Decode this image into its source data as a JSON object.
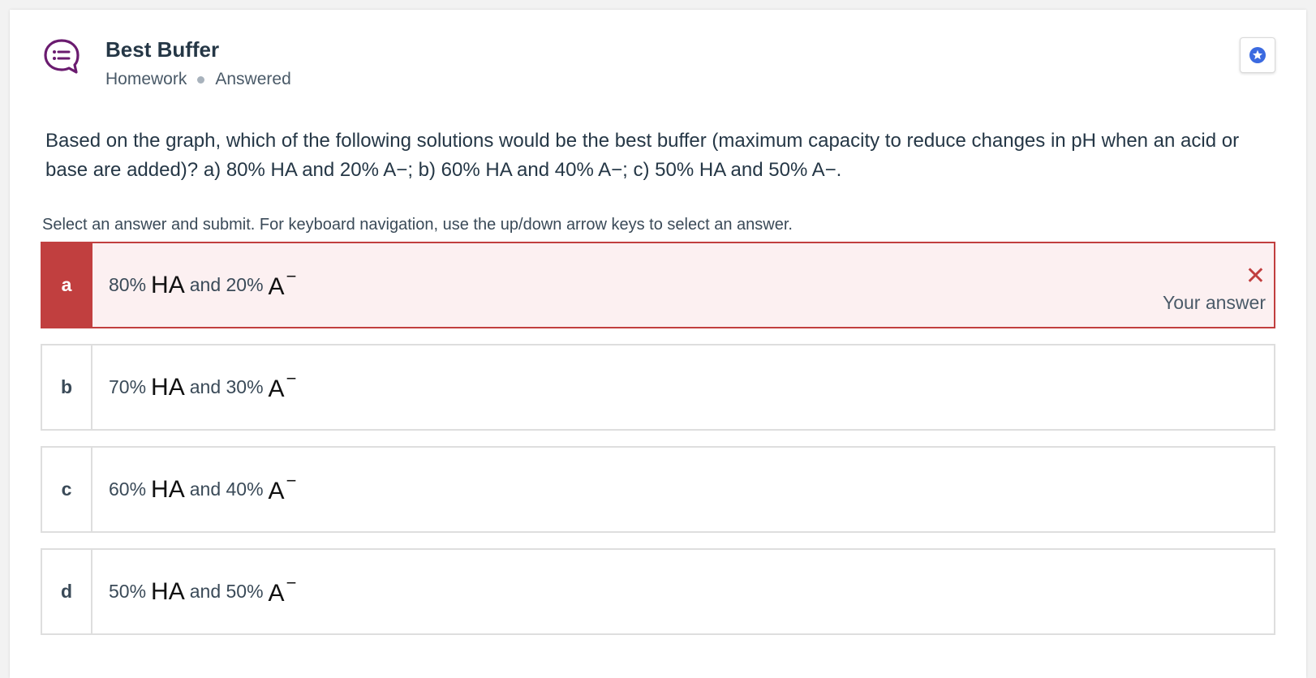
{
  "header": {
    "title": "Best Buffer",
    "category": "Homework",
    "status": "Answered",
    "icon": "quiz-chat-icon",
    "accent_color": "#6a1b6f"
  },
  "question": {
    "text": "Based on the graph, which of the following solutions would be the best buffer (maximum capacity to reduce changes in pH when an acid or base are added)? a) 80% HA and 20% A−; b) 60% HA and 40% A−; c) 50% HA and 50% A−."
  },
  "instructions": "Select an answer and submit. For keyboard navigation, use the up/down arrow keys to select an answer.",
  "options": [
    {
      "letter": "a",
      "pct1": "80%",
      "ha": "HA",
      "and": "and",
      "pct2": "20%",
      "a": "A",
      "charge": "−",
      "selected": true,
      "correct": false
    },
    {
      "letter": "b",
      "pct1": "70%",
      "ha": "HA",
      "and": "and",
      "pct2": "30%",
      "a": "A",
      "charge": "−"
    },
    {
      "letter": "c",
      "pct1": "60%",
      "ha": "HA",
      "and": "and",
      "pct2": "40%",
      "a": "A",
      "charge": "−"
    },
    {
      "letter": "d",
      "pct1": "50%",
      "ha": "HA",
      "and": "and",
      "pct2": "50%",
      "a": "A",
      "charge": "−"
    }
  ],
  "feedback": {
    "icon": "close-icon",
    "label": "Your answer",
    "color": "#c13f3f"
  }
}
